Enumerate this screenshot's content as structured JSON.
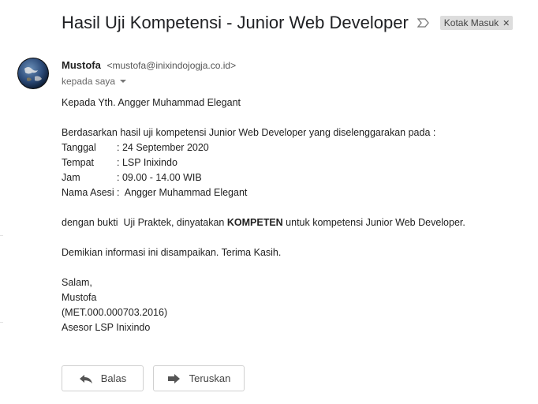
{
  "email": {
    "subject": "Hasil Uji Kompetensi - Junior Web Developer",
    "label": "Kotak Masuk",
    "sender_name": "Mustofa",
    "sender_email": "<mustofa@inixindojogja.co.id>",
    "to": "kepada saya",
    "body": {
      "greeting": "Kepada Yth. Angger Muhammad Elegant",
      "intro": "Berdasarkan hasil uji kompetensi Junior Web Developer yang diselenggarakan pada :",
      "details": [
        {
          "key": "Tanggal",
          "value": ": 24 September 2020"
        },
        {
          "key": "Tempat",
          "value": ": LSP Inixindo"
        },
        {
          "key": "Jam",
          "value": ": 09.00 - 14.00 WIB"
        },
        {
          "key": "Nama Asesi",
          "value": ":  Angger Muhammad Elegant"
        }
      ],
      "result_prefix": "dengan bukti  Uji Praktek, dinyatakan ",
      "result_bold": "KOMPETEN",
      "result_suffix": " untuk kompetensi Junior Web Developer.",
      "closing": "Demikian informasi ini disampaikan. Terima Kasih.",
      "signature": [
        "Salam,",
        "Mustofa",
        "(MET.000.000703.2016)",
        "Asesor LSP Inixindo"
      ]
    }
  },
  "actions": {
    "reply_label": "Balas",
    "forward_label": "Teruskan"
  },
  "icons": {
    "important": "important-marker-icon",
    "reply": "reply-arrow-icon",
    "forward": "forward-arrow-icon",
    "label_close": "close-icon"
  },
  "colors": {
    "label_bg": "#dddddd",
    "text": "#222222",
    "muted": "#666666"
  }
}
